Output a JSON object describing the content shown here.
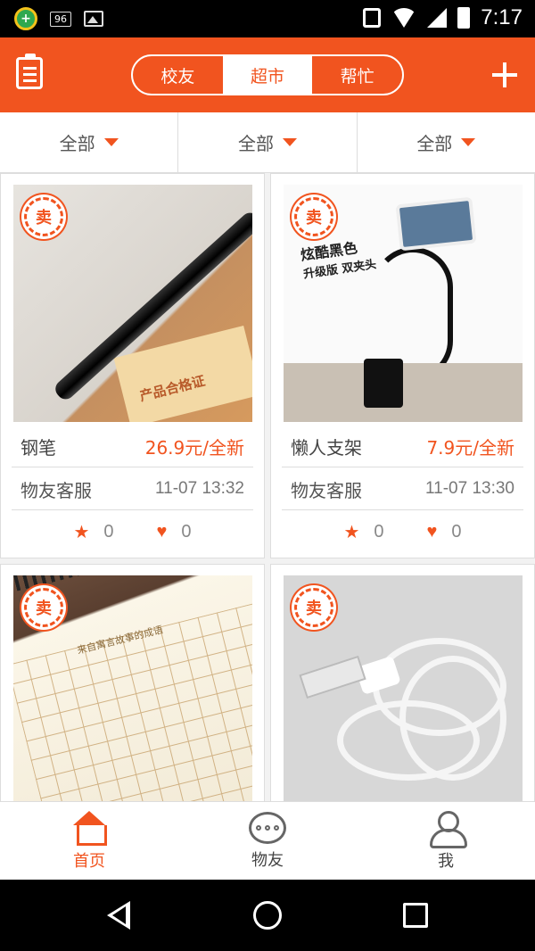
{
  "status_bar": {
    "notif_count": "96",
    "time": "7:17"
  },
  "header": {
    "segments": [
      "校友",
      "超市",
      "帮忙"
    ],
    "active_segment": 1
  },
  "filters": [
    "全部",
    "全部",
    "全部"
  ],
  "items": [
    {
      "badge": "卖",
      "name": "钢笔",
      "price": "26.9元/全新",
      "seller": "物友客服",
      "time": "11-07 13:32",
      "stars": "0",
      "likes": "0",
      "photo_text_a": "产品合格证"
    },
    {
      "badge": "卖",
      "name": "懒人支架",
      "price": "7.9元/全新",
      "seller": "物友客服",
      "time": "11-07 13:30",
      "stars": "0",
      "likes": "0",
      "photo_text_a": "炫酷黑色",
      "photo_text_b": "升级版 双夹头"
    },
    {
      "badge": "卖",
      "photo_text_a": "来自寓言故事的成语"
    },
    {
      "badge": "卖"
    }
  ],
  "tabbar": {
    "tabs": [
      "首页",
      "物友",
      "我"
    ],
    "active": 0
  },
  "colors": {
    "accent": "#f1541f",
    "background": "#f2f2f2",
    "status_bar": "#000000"
  }
}
